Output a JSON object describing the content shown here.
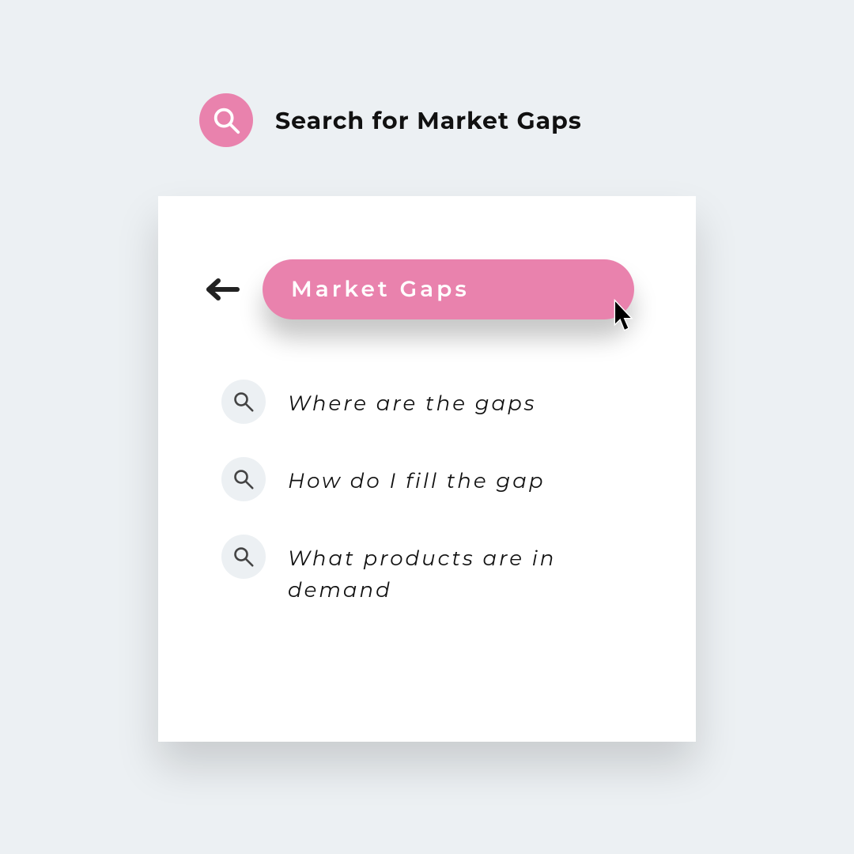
{
  "header": {
    "title": "Search for Market Gaps"
  },
  "search": {
    "query": "Market Gaps"
  },
  "suggestions": [
    {
      "label": "Where are the gaps"
    },
    {
      "label": "How do I fill the gap"
    },
    {
      "label": "What products are in demand"
    }
  ],
  "colors": {
    "accent": "#e982ad",
    "background": "#ecf0f3"
  }
}
